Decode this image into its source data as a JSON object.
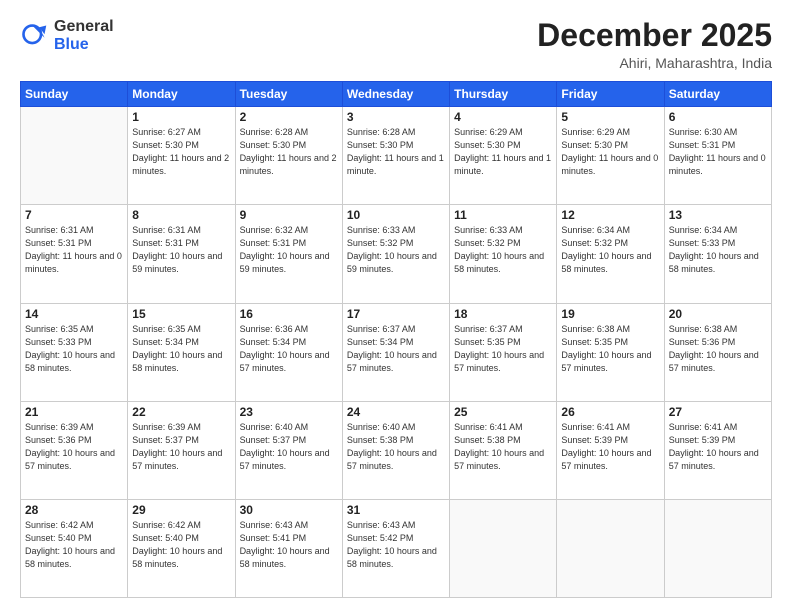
{
  "logo": {
    "general": "General",
    "blue": "Blue"
  },
  "header": {
    "month": "December 2025",
    "location": "Ahiri, Maharashtra, India"
  },
  "weekdays": [
    "Sunday",
    "Monday",
    "Tuesday",
    "Wednesday",
    "Thursday",
    "Friday",
    "Saturday"
  ],
  "rows": [
    [
      {
        "day": "",
        "sunrise": "",
        "sunset": "",
        "daylight": ""
      },
      {
        "day": "1",
        "sunrise": "Sunrise: 6:27 AM",
        "sunset": "Sunset: 5:30 PM",
        "daylight": "Daylight: 11 hours and 2 minutes."
      },
      {
        "day": "2",
        "sunrise": "Sunrise: 6:28 AM",
        "sunset": "Sunset: 5:30 PM",
        "daylight": "Daylight: 11 hours and 2 minutes."
      },
      {
        "day": "3",
        "sunrise": "Sunrise: 6:28 AM",
        "sunset": "Sunset: 5:30 PM",
        "daylight": "Daylight: 11 hours and 1 minute."
      },
      {
        "day": "4",
        "sunrise": "Sunrise: 6:29 AM",
        "sunset": "Sunset: 5:30 PM",
        "daylight": "Daylight: 11 hours and 1 minute."
      },
      {
        "day": "5",
        "sunrise": "Sunrise: 6:29 AM",
        "sunset": "Sunset: 5:30 PM",
        "daylight": "Daylight: 11 hours and 0 minutes."
      },
      {
        "day": "6",
        "sunrise": "Sunrise: 6:30 AM",
        "sunset": "Sunset: 5:31 PM",
        "daylight": "Daylight: 11 hours and 0 minutes."
      }
    ],
    [
      {
        "day": "7",
        "sunrise": "Sunrise: 6:31 AM",
        "sunset": "Sunset: 5:31 PM",
        "daylight": "Daylight: 11 hours and 0 minutes."
      },
      {
        "day": "8",
        "sunrise": "Sunrise: 6:31 AM",
        "sunset": "Sunset: 5:31 PM",
        "daylight": "Daylight: 10 hours and 59 minutes."
      },
      {
        "day": "9",
        "sunrise": "Sunrise: 6:32 AM",
        "sunset": "Sunset: 5:31 PM",
        "daylight": "Daylight: 10 hours and 59 minutes."
      },
      {
        "day": "10",
        "sunrise": "Sunrise: 6:33 AM",
        "sunset": "Sunset: 5:32 PM",
        "daylight": "Daylight: 10 hours and 59 minutes."
      },
      {
        "day": "11",
        "sunrise": "Sunrise: 6:33 AM",
        "sunset": "Sunset: 5:32 PM",
        "daylight": "Daylight: 10 hours and 58 minutes."
      },
      {
        "day": "12",
        "sunrise": "Sunrise: 6:34 AM",
        "sunset": "Sunset: 5:32 PM",
        "daylight": "Daylight: 10 hours and 58 minutes."
      },
      {
        "day": "13",
        "sunrise": "Sunrise: 6:34 AM",
        "sunset": "Sunset: 5:33 PM",
        "daylight": "Daylight: 10 hours and 58 minutes."
      }
    ],
    [
      {
        "day": "14",
        "sunrise": "Sunrise: 6:35 AM",
        "sunset": "Sunset: 5:33 PM",
        "daylight": "Daylight: 10 hours and 58 minutes."
      },
      {
        "day": "15",
        "sunrise": "Sunrise: 6:35 AM",
        "sunset": "Sunset: 5:34 PM",
        "daylight": "Daylight: 10 hours and 58 minutes."
      },
      {
        "day": "16",
        "sunrise": "Sunrise: 6:36 AM",
        "sunset": "Sunset: 5:34 PM",
        "daylight": "Daylight: 10 hours and 57 minutes."
      },
      {
        "day": "17",
        "sunrise": "Sunrise: 6:37 AM",
        "sunset": "Sunset: 5:34 PM",
        "daylight": "Daylight: 10 hours and 57 minutes."
      },
      {
        "day": "18",
        "sunrise": "Sunrise: 6:37 AM",
        "sunset": "Sunset: 5:35 PM",
        "daylight": "Daylight: 10 hours and 57 minutes."
      },
      {
        "day": "19",
        "sunrise": "Sunrise: 6:38 AM",
        "sunset": "Sunset: 5:35 PM",
        "daylight": "Daylight: 10 hours and 57 minutes."
      },
      {
        "day": "20",
        "sunrise": "Sunrise: 6:38 AM",
        "sunset": "Sunset: 5:36 PM",
        "daylight": "Daylight: 10 hours and 57 minutes."
      }
    ],
    [
      {
        "day": "21",
        "sunrise": "Sunrise: 6:39 AM",
        "sunset": "Sunset: 5:36 PM",
        "daylight": "Daylight: 10 hours and 57 minutes."
      },
      {
        "day": "22",
        "sunrise": "Sunrise: 6:39 AM",
        "sunset": "Sunset: 5:37 PM",
        "daylight": "Daylight: 10 hours and 57 minutes."
      },
      {
        "day": "23",
        "sunrise": "Sunrise: 6:40 AM",
        "sunset": "Sunset: 5:37 PM",
        "daylight": "Daylight: 10 hours and 57 minutes."
      },
      {
        "day": "24",
        "sunrise": "Sunrise: 6:40 AM",
        "sunset": "Sunset: 5:38 PM",
        "daylight": "Daylight: 10 hours and 57 minutes."
      },
      {
        "day": "25",
        "sunrise": "Sunrise: 6:41 AM",
        "sunset": "Sunset: 5:38 PM",
        "daylight": "Daylight: 10 hours and 57 minutes."
      },
      {
        "day": "26",
        "sunrise": "Sunrise: 6:41 AM",
        "sunset": "Sunset: 5:39 PM",
        "daylight": "Daylight: 10 hours and 57 minutes."
      },
      {
        "day": "27",
        "sunrise": "Sunrise: 6:41 AM",
        "sunset": "Sunset: 5:39 PM",
        "daylight": "Daylight: 10 hours and 57 minutes."
      }
    ],
    [
      {
        "day": "28",
        "sunrise": "Sunrise: 6:42 AM",
        "sunset": "Sunset: 5:40 PM",
        "daylight": "Daylight: 10 hours and 58 minutes."
      },
      {
        "day": "29",
        "sunrise": "Sunrise: 6:42 AM",
        "sunset": "Sunset: 5:40 PM",
        "daylight": "Daylight: 10 hours and 58 minutes."
      },
      {
        "day": "30",
        "sunrise": "Sunrise: 6:43 AM",
        "sunset": "Sunset: 5:41 PM",
        "daylight": "Daylight: 10 hours and 58 minutes."
      },
      {
        "day": "31",
        "sunrise": "Sunrise: 6:43 AM",
        "sunset": "Sunset: 5:42 PM",
        "daylight": "Daylight: 10 hours and 58 minutes."
      },
      {
        "day": "",
        "sunrise": "",
        "sunset": "",
        "daylight": ""
      },
      {
        "day": "",
        "sunrise": "",
        "sunset": "",
        "daylight": ""
      },
      {
        "day": "",
        "sunrise": "",
        "sunset": "",
        "daylight": ""
      }
    ]
  ]
}
